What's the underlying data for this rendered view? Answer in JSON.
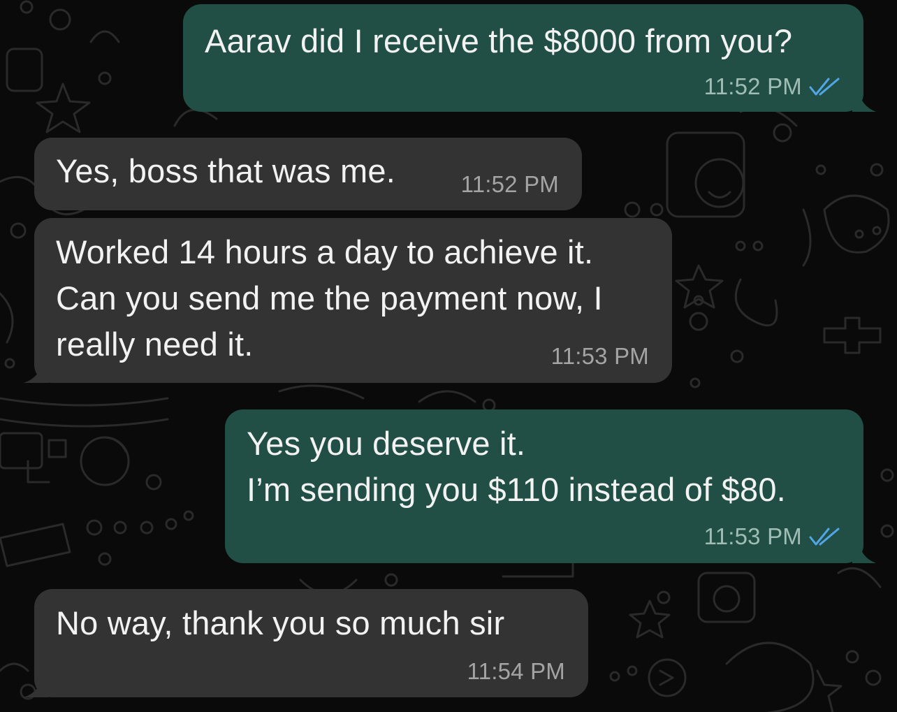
{
  "conversation": {
    "messages": [
      {
        "direction": "outgoing",
        "lines": [
          "Aarav did I receive the $8000 from you?"
        ],
        "time": "11:52 PM",
        "status": "read",
        "status_icon": "double-check-icon"
      },
      {
        "direction": "incoming",
        "lines": [
          "Yes, boss that was me."
        ],
        "time": "11:52 PM"
      },
      {
        "direction": "incoming",
        "lines": [
          "Worked 14 hours a day to achieve it.",
          "Can you send me the payment now, I",
          "really need it."
        ],
        "time": "11:53 PM"
      },
      {
        "direction": "outgoing",
        "lines": [
          "Yes you deserve it.",
          "I’m sending you $110 instead of $80."
        ],
        "time": "11:53 PM",
        "status": "read",
        "status_icon": "double-check-icon"
      },
      {
        "direction": "incoming",
        "lines": [
          "No way, thank you so much sir"
        ],
        "time": "11:54 PM"
      }
    ]
  },
  "colors": {
    "background": "#0a0a0a",
    "outgoing_bubble": "#214f45",
    "incoming_bubble": "#333334",
    "text": "#f2f2f2",
    "read_ticks": "#53a6e6"
  }
}
